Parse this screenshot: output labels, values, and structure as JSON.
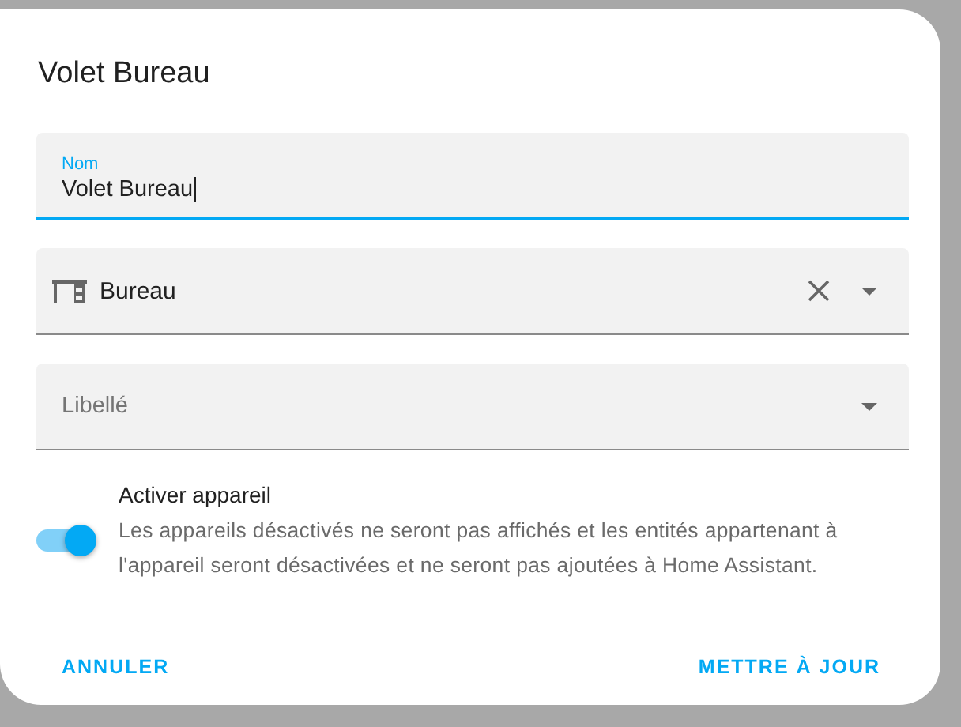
{
  "dialog": {
    "title": "Volet Bureau"
  },
  "name_field": {
    "label": "Nom",
    "value": "Volet Bureau"
  },
  "area_field": {
    "value": "Bureau"
  },
  "label_field": {
    "placeholder": "Libellé"
  },
  "enable": {
    "title": "Activer appareil",
    "description": "Les appareils désactivés ne seront pas affichés et les entités appartenant à l'appareil seront désactivées et ne seront pas ajoutées à Home Assistant.",
    "on": true
  },
  "buttons": [
    "ANNULER",
    "METTRE À JOUR"
  ]
}
